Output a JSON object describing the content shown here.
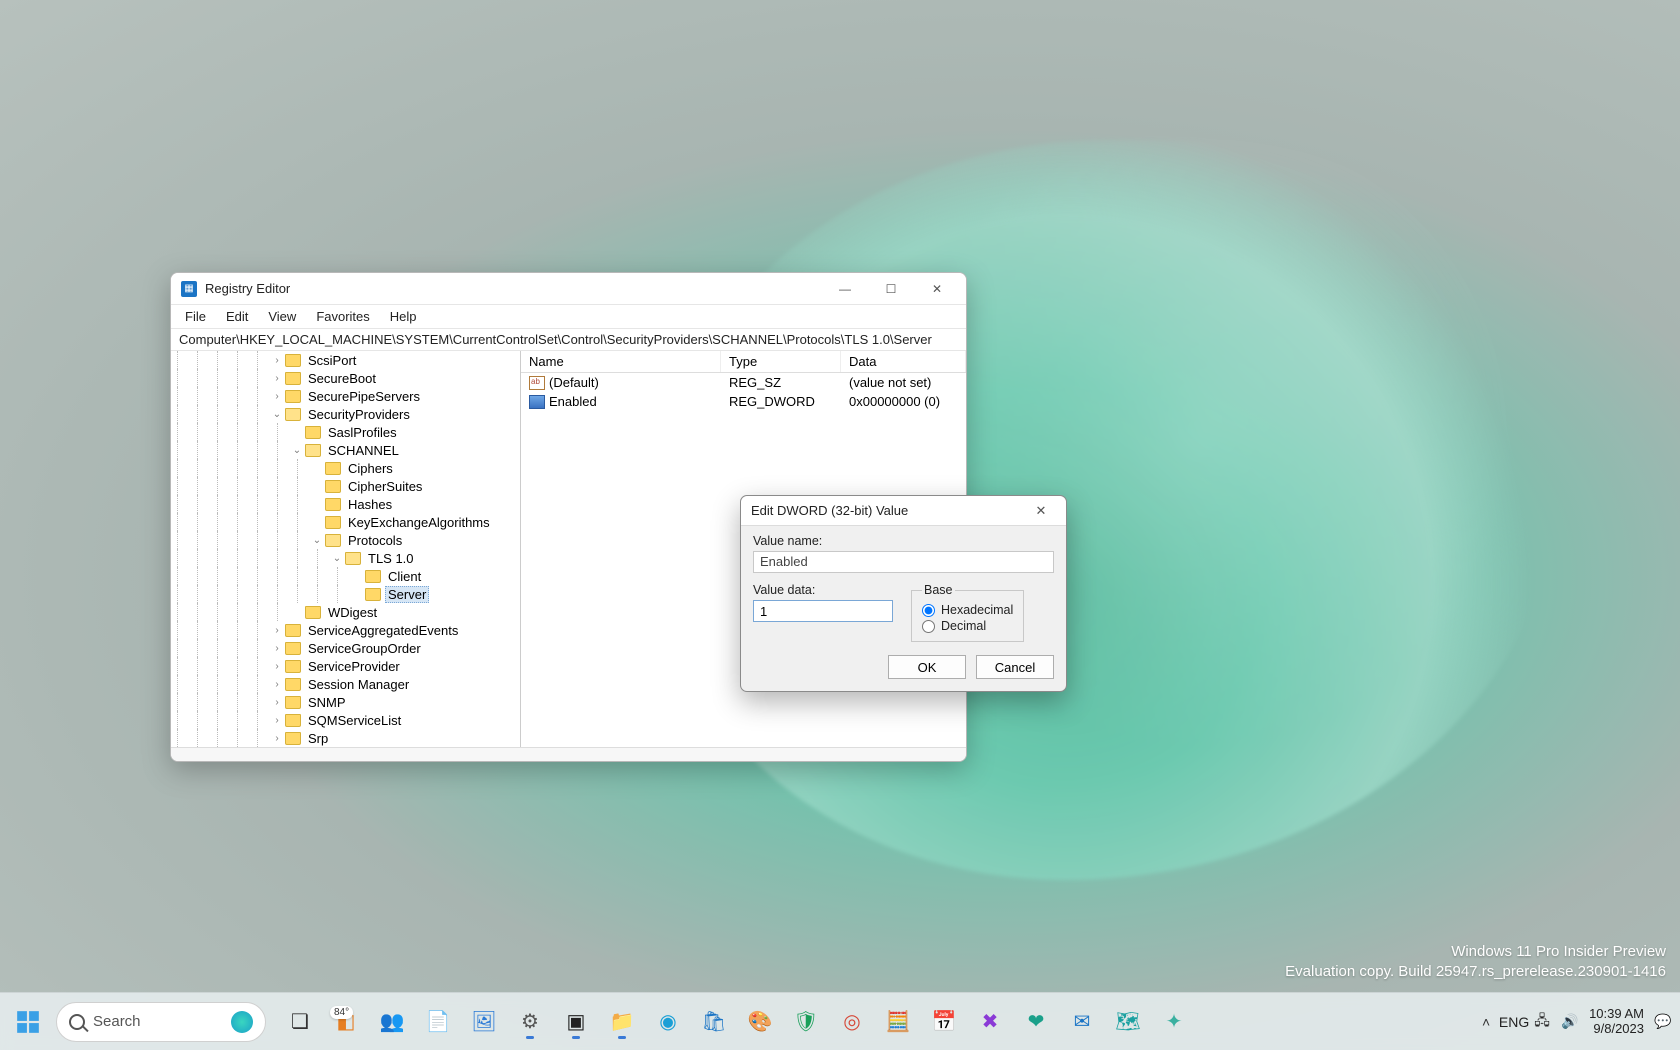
{
  "regedit": {
    "title": "Registry Editor",
    "menu": {
      "file": "File",
      "edit": "Edit",
      "view": "View",
      "favorites": "Favorites",
      "help": "Help"
    },
    "address": "Computer\\HKEY_LOCAL_MACHINE\\SYSTEM\\CurrentControlSet\\Control\\SecurityProviders\\SCHANNEL\\Protocols\\TLS 1.0\\Server",
    "tree": [
      {
        "indent": 5,
        "expander": ">",
        "label": "ScsiPort"
      },
      {
        "indent": 5,
        "expander": ">",
        "label": "SecureBoot"
      },
      {
        "indent": 5,
        "expander": ">",
        "label": "SecurePipeServers"
      },
      {
        "indent": 5,
        "expander": "v",
        "label": "SecurityProviders",
        "open": true
      },
      {
        "indent": 6,
        "expander": "",
        "label": "SaslProfiles"
      },
      {
        "indent": 6,
        "expander": "v",
        "label": "SCHANNEL",
        "open": true
      },
      {
        "indent": 7,
        "expander": "",
        "label": "Ciphers"
      },
      {
        "indent": 7,
        "expander": "",
        "label": "CipherSuites"
      },
      {
        "indent": 7,
        "expander": "",
        "label": "Hashes"
      },
      {
        "indent": 7,
        "expander": "",
        "label": "KeyExchangeAlgorithms"
      },
      {
        "indent": 7,
        "expander": "v",
        "label": "Protocols",
        "open": true
      },
      {
        "indent": 8,
        "expander": "v",
        "label": "TLS 1.0",
        "open": true
      },
      {
        "indent": 9,
        "expander": "",
        "label": "Client"
      },
      {
        "indent": 9,
        "expander": "",
        "label": "Server",
        "selected": true
      },
      {
        "indent": 6,
        "expander": "",
        "label": "WDigest"
      },
      {
        "indent": 5,
        "expander": ">",
        "label": "ServiceAggregatedEvents"
      },
      {
        "indent": 5,
        "expander": ">",
        "label": "ServiceGroupOrder"
      },
      {
        "indent": 5,
        "expander": ">",
        "label": "ServiceProvider"
      },
      {
        "indent": 5,
        "expander": ">",
        "label": "Session Manager"
      },
      {
        "indent": 5,
        "expander": ">",
        "label": "SNMP"
      },
      {
        "indent": 5,
        "expander": ">",
        "label": "SQMServiceList"
      },
      {
        "indent": 5,
        "expander": ">",
        "label": "Srp"
      }
    ],
    "list": {
      "headers": {
        "name": "Name",
        "type": "Type",
        "data": "Data"
      },
      "rows": [
        {
          "icon": "str",
          "name": "(Default)",
          "type": "REG_SZ",
          "data": "(value not set)"
        },
        {
          "icon": "dw",
          "name": "Enabled",
          "type": "REG_DWORD",
          "data": "0x00000000 (0)"
        }
      ]
    }
  },
  "dword_dialog": {
    "title": "Edit DWORD (32-bit) Value",
    "value_name_label": "Value name:",
    "value_name": "Enabled",
    "value_data_label": "Value data:",
    "value_data": "1",
    "base_label": "Base",
    "hex_label": "Hexadecimal",
    "dec_label": "Decimal",
    "base_selected": "hex",
    "ok": "OK",
    "cancel": "Cancel"
  },
  "taskbar": {
    "search_placeholder": "Search",
    "weather_badge": "84°",
    "icons": [
      {
        "name": "task-view-icon",
        "glyph": "❏",
        "color": "#333"
      },
      {
        "name": "widgets-icon",
        "glyph": "◧",
        "color": "#e67e22",
        "badge": "84°"
      },
      {
        "name": "teams-icon",
        "glyph": "👥",
        "color": "#5b5fc7"
      },
      {
        "name": "sticky-notes-icon",
        "glyph": "📄",
        "color": "#3a7ad6"
      },
      {
        "name": "photos-icon",
        "glyph": "🖼",
        "color": "#2a7ad6"
      },
      {
        "name": "settings-icon",
        "glyph": "⚙",
        "color": "#555",
        "active": true
      },
      {
        "name": "terminal-icon",
        "glyph": "▣",
        "color": "#222",
        "active": true
      },
      {
        "name": "explorer-icon",
        "glyph": "📁",
        "color": "#f7c04a",
        "active": true
      },
      {
        "name": "edge-icon",
        "glyph": "◉",
        "color": "#1a9fd6"
      },
      {
        "name": "store-icon",
        "glyph": "🛍",
        "color": "#1a74c5"
      },
      {
        "name": "paint-icon",
        "glyph": "🎨",
        "color": "#e67e22"
      },
      {
        "name": "security-icon",
        "glyph": "🛡",
        "color": "#1a9f5a"
      },
      {
        "name": "chrome-icon",
        "glyph": "◎",
        "color": "#d64a3a"
      },
      {
        "name": "calculator-icon",
        "glyph": "🧮",
        "color": "#1a5fc5"
      },
      {
        "name": "calendar-icon",
        "glyph": "📅",
        "color": "#1a5fc5"
      },
      {
        "name": "xbox-icon",
        "glyph": "✖",
        "color": "#8a3ad6"
      },
      {
        "name": "health-icon",
        "glyph": "❤",
        "color": "#1aa08a"
      },
      {
        "name": "mail-icon",
        "glyph": "✉",
        "color": "#1a74c5"
      },
      {
        "name": "maps-icon",
        "glyph": "🗺",
        "color": "#1aa0a0"
      },
      {
        "name": "app-icon",
        "glyph": "✦",
        "color": "#3ab0a0"
      }
    ],
    "tray": {
      "lang": "ENG",
      "time": "10:39 AM",
      "date": "9/8/2023"
    }
  },
  "watermark": {
    "line1": "Windows 11 Pro Insider Preview",
    "line2": "Evaluation copy. Build 25947.rs_prerelease.230901-1416"
  }
}
